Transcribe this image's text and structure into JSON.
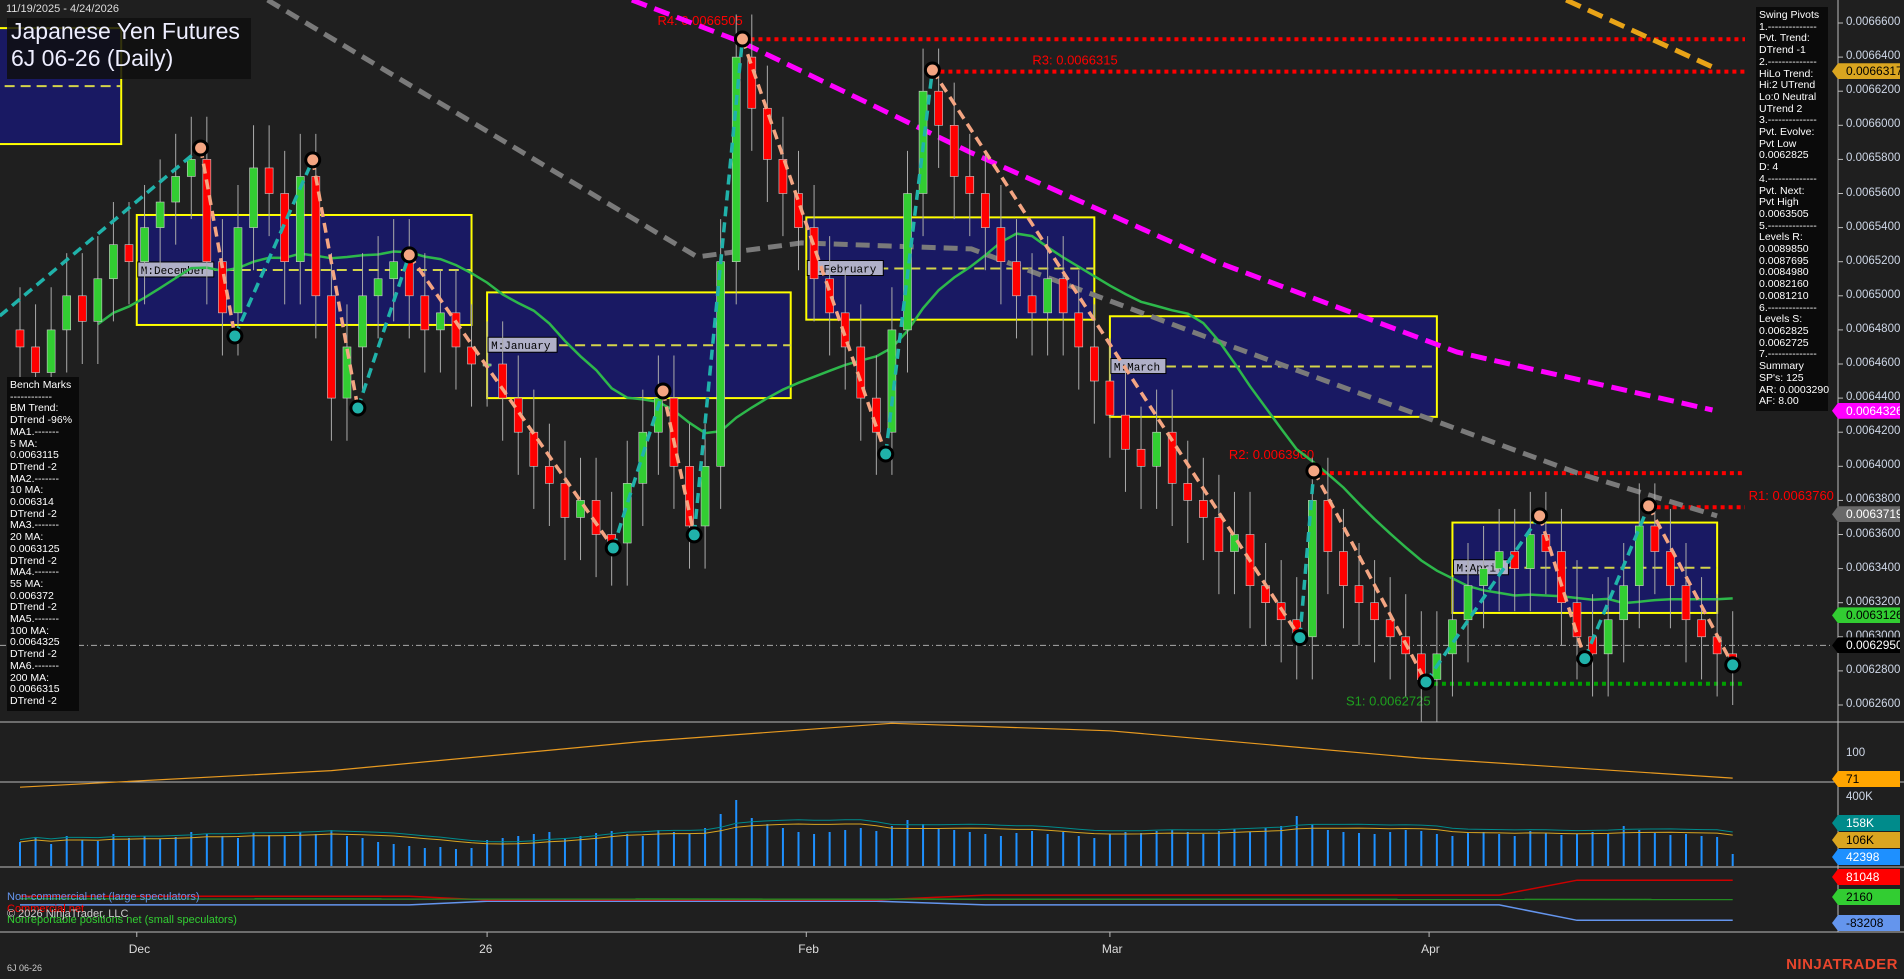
{
  "header": {
    "date_range": "11/19/2025 - 4/24/2026",
    "title_line1": "Japanese Yen Futures",
    "title_line2": "6J 06-26 (Daily)"
  },
  "bench_marks": [
    "Bench Marks",
    "------------",
    "BM Trend:",
    "DTrend -96%",
    "MA1.-------",
    "5 MA:",
    "0.0063115",
    "DTrend -2",
    "MA2.-------",
    "10 MA:",
    "0.006314",
    "DTrend -2",
    "MA3.-------",
    "20 MA:",
    "0.0063125",
    "DTrend -2",
    "MA4.-------",
    "55 MA:",
    "0.006372",
    "DTrend -2",
    "MA5.-------",
    "100 MA:",
    "0.0064325",
    "DTrend -2",
    "MA6.-------",
    "200 MA:",
    "0.0066315",
    "DTrend -2"
  ],
  "swing_pivots": [
    "Swing Pivots",
    "1.--------------",
    "Pvt. Trend:",
    "DTrend -1",
    "2.--------------",
    "HiLo Trend:",
    "Hi:2 UTrend",
    "Lo:0 Neutral",
    "UTrend 2",
    "3.--------------",
    "Pvt. Evolve:",
    "Pvt Low",
    "0.0062825",
    "D: 4",
    "4.--------------",
    "Pvt. Next:",
    "Pvt High",
    "0.0063505",
    "5.--------------",
    "Levels R:",
    "0.0089850",
    "0.0087695",
    "0.0084980",
    "0.0082160",
    "0.0081210",
    "6.--------------",
    "Levels S:",
    "0.0062825",
    "0.0062725",
    "7.--------------",
    "Summary",
    "SP's: 125",
    "AR: 0.0003290",
    "AF: 8.00"
  ],
  "price_axis": [
    "0.0066600",
    "0.0066400",
    "0.0066200",
    "0.0066000",
    "0.0065800",
    "0.0065600",
    "0.0065400",
    "0.0065200",
    "0.0065000",
    "0.0064800",
    "0.0064600",
    "0.0064400",
    "0.0064200",
    "0.0064000",
    "0.0063800",
    "0.0063600",
    "0.0063400",
    "0.0063200",
    "0.0063000",
    "0.0062800",
    "0.0062600"
  ],
  "price_tags": [
    {
      "text": "0.0066317",
      "value": 0.0066317,
      "bg": "#daa520",
      "fg": "#000000"
    },
    {
      "text": "0.0064326",
      "value": 0.0064326,
      "bg": "#ff00ff",
      "fg": "#ffffff"
    },
    {
      "text": "0.0063719",
      "value": 0.0063719,
      "bg": "#696969",
      "fg": "#ffffff"
    },
    {
      "text": "0.0063126",
      "value": 0.0063126,
      "bg": "#32cd32",
      "fg": "#000000"
    },
    {
      "text": "0.0062950",
      "value": 0.006295,
      "bg": "#000000",
      "fg": "#ffffff"
    }
  ],
  "levels": [
    {
      "label": "R4: 0.0066505",
      "value": 0.0066505,
      "from_bar": 46.4
    },
    {
      "label": "R3: 0.0066315",
      "value": 0.0066315,
      "from_bar": 58.6
    },
    {
      "label": "R2: 0.0063960",
      "value": 0.006396,
      "from_bar": 83.1
    },
    {
      "label": "R1: 0.0063760",
      "value": 0.006376,
      "from_bar": 104.6
    },
    {
      "label": "S1: 0.0062725",
      "value": 0.0062725,
      "from_bar": 90.3
    }
  ],
  "month_boxes": [
    {
      "label": "",
      "start": -1.5,
      "end": 6.5,
      "high": 0.006657,
      "low": 0.006589
    },
    {
      "label": "M:December",
      "start": 7.5,
      "end": 29,
      "high": 0.0065474,
      "low": 0.0064829
    },
    {
      "label": "M:January",
      "start": 30,
      "end": 49.5,
      "high": 0.006502,
      "low": 0.00644
    },
    {
      "label": "M:February",
      "start": 50.5,
      "end": 69,
      "high": 0.006546,
      "low": 0.006486
    },
    {
      "label": "M:March",
      "start": 70,
      "end": 91,
      "high": 0.006488,
      "low": 0.006429
    },
    {
      "label": "M:April",
      "start": 92,
      "end": 109,
      "high": 0.006367,
      "low": 0.006314
    }
  ],
  "oscillator_axis": {
    "tick": "100",
    "tag": "71"
  },
  "volume_axis": {
    "tick": "400K",
    "tags": [
      {
        "text": "158K",
        "bg": "#008b8b"
      },
      {
        "text": "106K",
        "bg": "#daa520"
      },
      {
        "text": "42398",
        "bg": "#1e90ff"
      }
    ]
  },
  "cot": {
    "legend": [
      "Non-commercial net (large speculators)",
      "Commercial net",
      "Nonreportable positions net (small speculators)"
    ],
    "copyright": "© 2026 NinjaTrader, LLC",
    "tags": [
      {
        "text": "81048",
        "bg": "#ff0000",
        "fg": "#ffffff"
      },
      {
        "text": "2160",
        "bg": "#32cd32",
        "fg": "#000000"
      },
      {
        "text": "-83208",
        "bg": "#6495ed",
        "fg": "#000000"
      }
    ]
  },
  "time_axis": [
    {
      "label": "Dec",
      "bar": 7.5
    },
    {
      "label": "26",
      "bar": 30
    },
    {
      "label": "Feb",
      "bar": 50.5
    },
    {
      "label": "Mar",
      "bar": 70
    },
    {
      "label": "Apr",
      "bar": 90.5
    }
  ],
  "footer": {
    "symbol": "6J 06-26",
    "brand": "NINJATRADER"
  },
  "colors": {
    "up": "#32cd32",
    "down": "#ff0000",
    "ma20": "#2db84b",
    "ma_grey": "#7a7a7a",
    "ma_magenta": "#ff00ff",
    "ma_orange": "#e8a317",
    "swing_up": "#20b2aa",
    "swing_down": "#f4a582",
    "box": "#ffff00",
    "box_fill": "#191970",
    "level": "#ff0000",
    "support": "#00a000"
  },
  "chart_data": {
    "type": "candlestick",
    "title": "Japanese Yen Futures 6J 06-26 (Daily)",
    "closes": [
      0.00647,
      0.006455,
      0.00648,
      0.0065,
      0.006485,
      0.00651,
      0.00653,
      0.00652,
      0.00654,
      0.006555,
      0.00657,
      0.00658,
      0.00652,
      0.00649,
      0.00654,
      0.006575,
      0.00656,
      0.00652,
      0.00657,
      0.0065,
      0.00644,
      0.00647,
      0.0065,
      0.00651,
      0.00652,
      0.0065,
      0.00648,
      0.00649,
      0.00647,
      0.00646,
      0.00646,
      0.00644,
      0.00642,
      0.0064,
      0.00639,
      0.00637,
      0.00638,
      0.00636,
      0.006355,
      0.00639,
      0.00642,
      0.00644,
      0.0064,
      0.006365,
      0.0064,
      0.00652,
      0.00664,
      0.00661,
      0.00658,
      0.00656,
      0.00654,
      0.00651,
      0.00649,
      0.00647,
      0.00644,
      0.00642,
      0.00648,
      0.00656,
      0.00662,
      0.0066,
      0.00657,
      0.00656,
      0.00654,
      0.00652,
      0.0065,
      0.00649,
      0.00651,
      0.00649,
      0.00647,
      0.00645,
      0.00643,
      0.00641,
      0.0064,
      0.00642,
      0.00639,
      0.00638,
      0.00637,
      0.00635,
      0.00636,
      0.00633,
      0.00632,
      0.00631,
      0.0063,
      0.00638,
      0.00635,
      0.00633,
      0.00632,
      0.00631,
      0.0063,
      0.00629,
      0.006275,
      0.00629,
      0.00631,
      0.00633,
      0.00634,
      0.00635,
      0.00634,
      0.00636,
      0.00635,
      0.00632,
      0.0063,
      0.00629,
      0.00631,
      0.00633,
      0.006365,
      0.00635,
      0.00633,
      0.00631,
      0.0063,
      0.00629,
      0.006285
    ],
    "volume_k": [
      120,
      140,
      110,
      150,
      130,
      125,
      160,
      140,
      150,
      135,
      145,
      170,
      160,
      150,
      140,
      165,
      155,
      150,
      170,
      160,
      180,
      150,
      140,
      120,
      110,
      100,
      90,
      95,
      85,
      90,
      130,
      140,
      150,
      160,
      170,
      140,
      150,
      165,
      175,
      160,
      150,
      180,
      170,
      160,
      190,
      260,
      330,
      240,
      210,
      190,
      170,
      160,
      170,
      180,
      190,
      175,
      200,
      230,
      210,
      190,
      180,
      170,
      160,
      150,
      165,
      175,
      160,
      170,
      150,
      140,
      160,
      170,
      165,
      175,
      180,
      170,
      160,
      175,
      185,
      170,
      190,
      200,
      250,
      210,
      180,
      170,
      165,
      160,
      170,
      180,
      175,
      160,
      150,
      165,
      170,
      160,
      150,
      175,
      165,
      155,
      160,
      170,
      160,
      200,
      180,
      165,
      155,
      160,
      150,
      145,
      60
    ],
    "swing_points": [
      [
        -1.3,
        0.0064882
      ],
      [
        11.6,
        0.0065867
      ],
      [
        13.8,
        0.0064764
      ],
      [
        18.8,
        0.0065797
      ],
      [
        21.7,
        0.0064342
      ],
      [
        25,
        0.006524
      ],
      [
        38.1,
        0.0063521
      ],
      [
        41.3,
        0.0064442
      ],
      [
        43.3,
        0.0063598
      ],
      [
        46.4,
        0.0066506
      ],
      [
        55.6,
        0.0064072
      ],
      [
        58.6,
        0.0066324
      ],
      [
        82.2,
        0.0062995
      ],
      [
        83.1,
        0.0063973
      ],
      [
        90.3,
        0.0062735
      ],
      [
        97.6,
        0.0063709
      ],
      [
        100.5,
        0.0062872
      ],
      [
        104.6,
        0.0063768
      ],
      [
        110,
        0.0062835
      ]
    ],
    "ma_grey": [
      [
        15.9,
        0.0066735
      ],
      [
        43.5,
        0.0065228
      ],
      [
        50.2,
        0.006531
      ],
      [
        61.1,
        0.0065275
      ],
      [
        76.7,
        0.0064741
      ],
      [
        100,
        0.0063961
      ],
      [
        109,
        0.0063709
      ]
    ],
    "ma_magenta": [
      [
        39.3,
        0.0066735
      ],
      [
        46.3,
        0.0066489
      ],
      [
        61,
        0.0065843
      ],
      [
        76.7,
        0.0065204
      ],
      [
        92.3,
        0.006467
      ],
      [
        108.7,
        0.006433
      ]
    ],
    "ma_orange": [
      [
        99.3,
        0.0066735
      ],
      [
        108.7,
        0.0066342
      ]
    ],
    "close_marker": 0.006295,
    "oscillator": [
      [
        0,
        60
      ],
      [
        20,
        80
      ],
      [
        40,
        115
      ],
      [
        56,
        137
      ],
      [
        70,
        128
      ],
      [
        90,
        95
      ],
      [
        110,
        71
      ]
    ],
    "cot_series": {
      "large_speculators": [
        [
          0,
          -20000
        ],
        [
          25,
          -20000
        ],
        [
          30,
          -5000
        ],
        [
          55,
          -5000
        ],
        [
          62,
          -20000
        ],
        [
          80,
          -20000
        ],
        [
          95,
          -20000
        ],
        [
          100,
          -83208
        ],
        [
          110,
          -83208
        ]
      ],
      "commercial": [
        [
          0,
          15000
        ],
        [
          25,
          15000
        ],
        [
          30,
          0
        ],
        [
          55,
          0
        ],
        [
          62,
          20000
        ],
        [
          80,
          20000
        ],
        [
          95,
          20000
        ],
        [
          100,
          81048
        ],
        [
          110,
          81048
        ]
      ],
      "small_speculators": [
        [
          0,
          5000
        ],
        [
          110,
          2160
        ]
      ]
    },
    "ylim": [
      0.00625,
      0.00668
    ]
  }
}
